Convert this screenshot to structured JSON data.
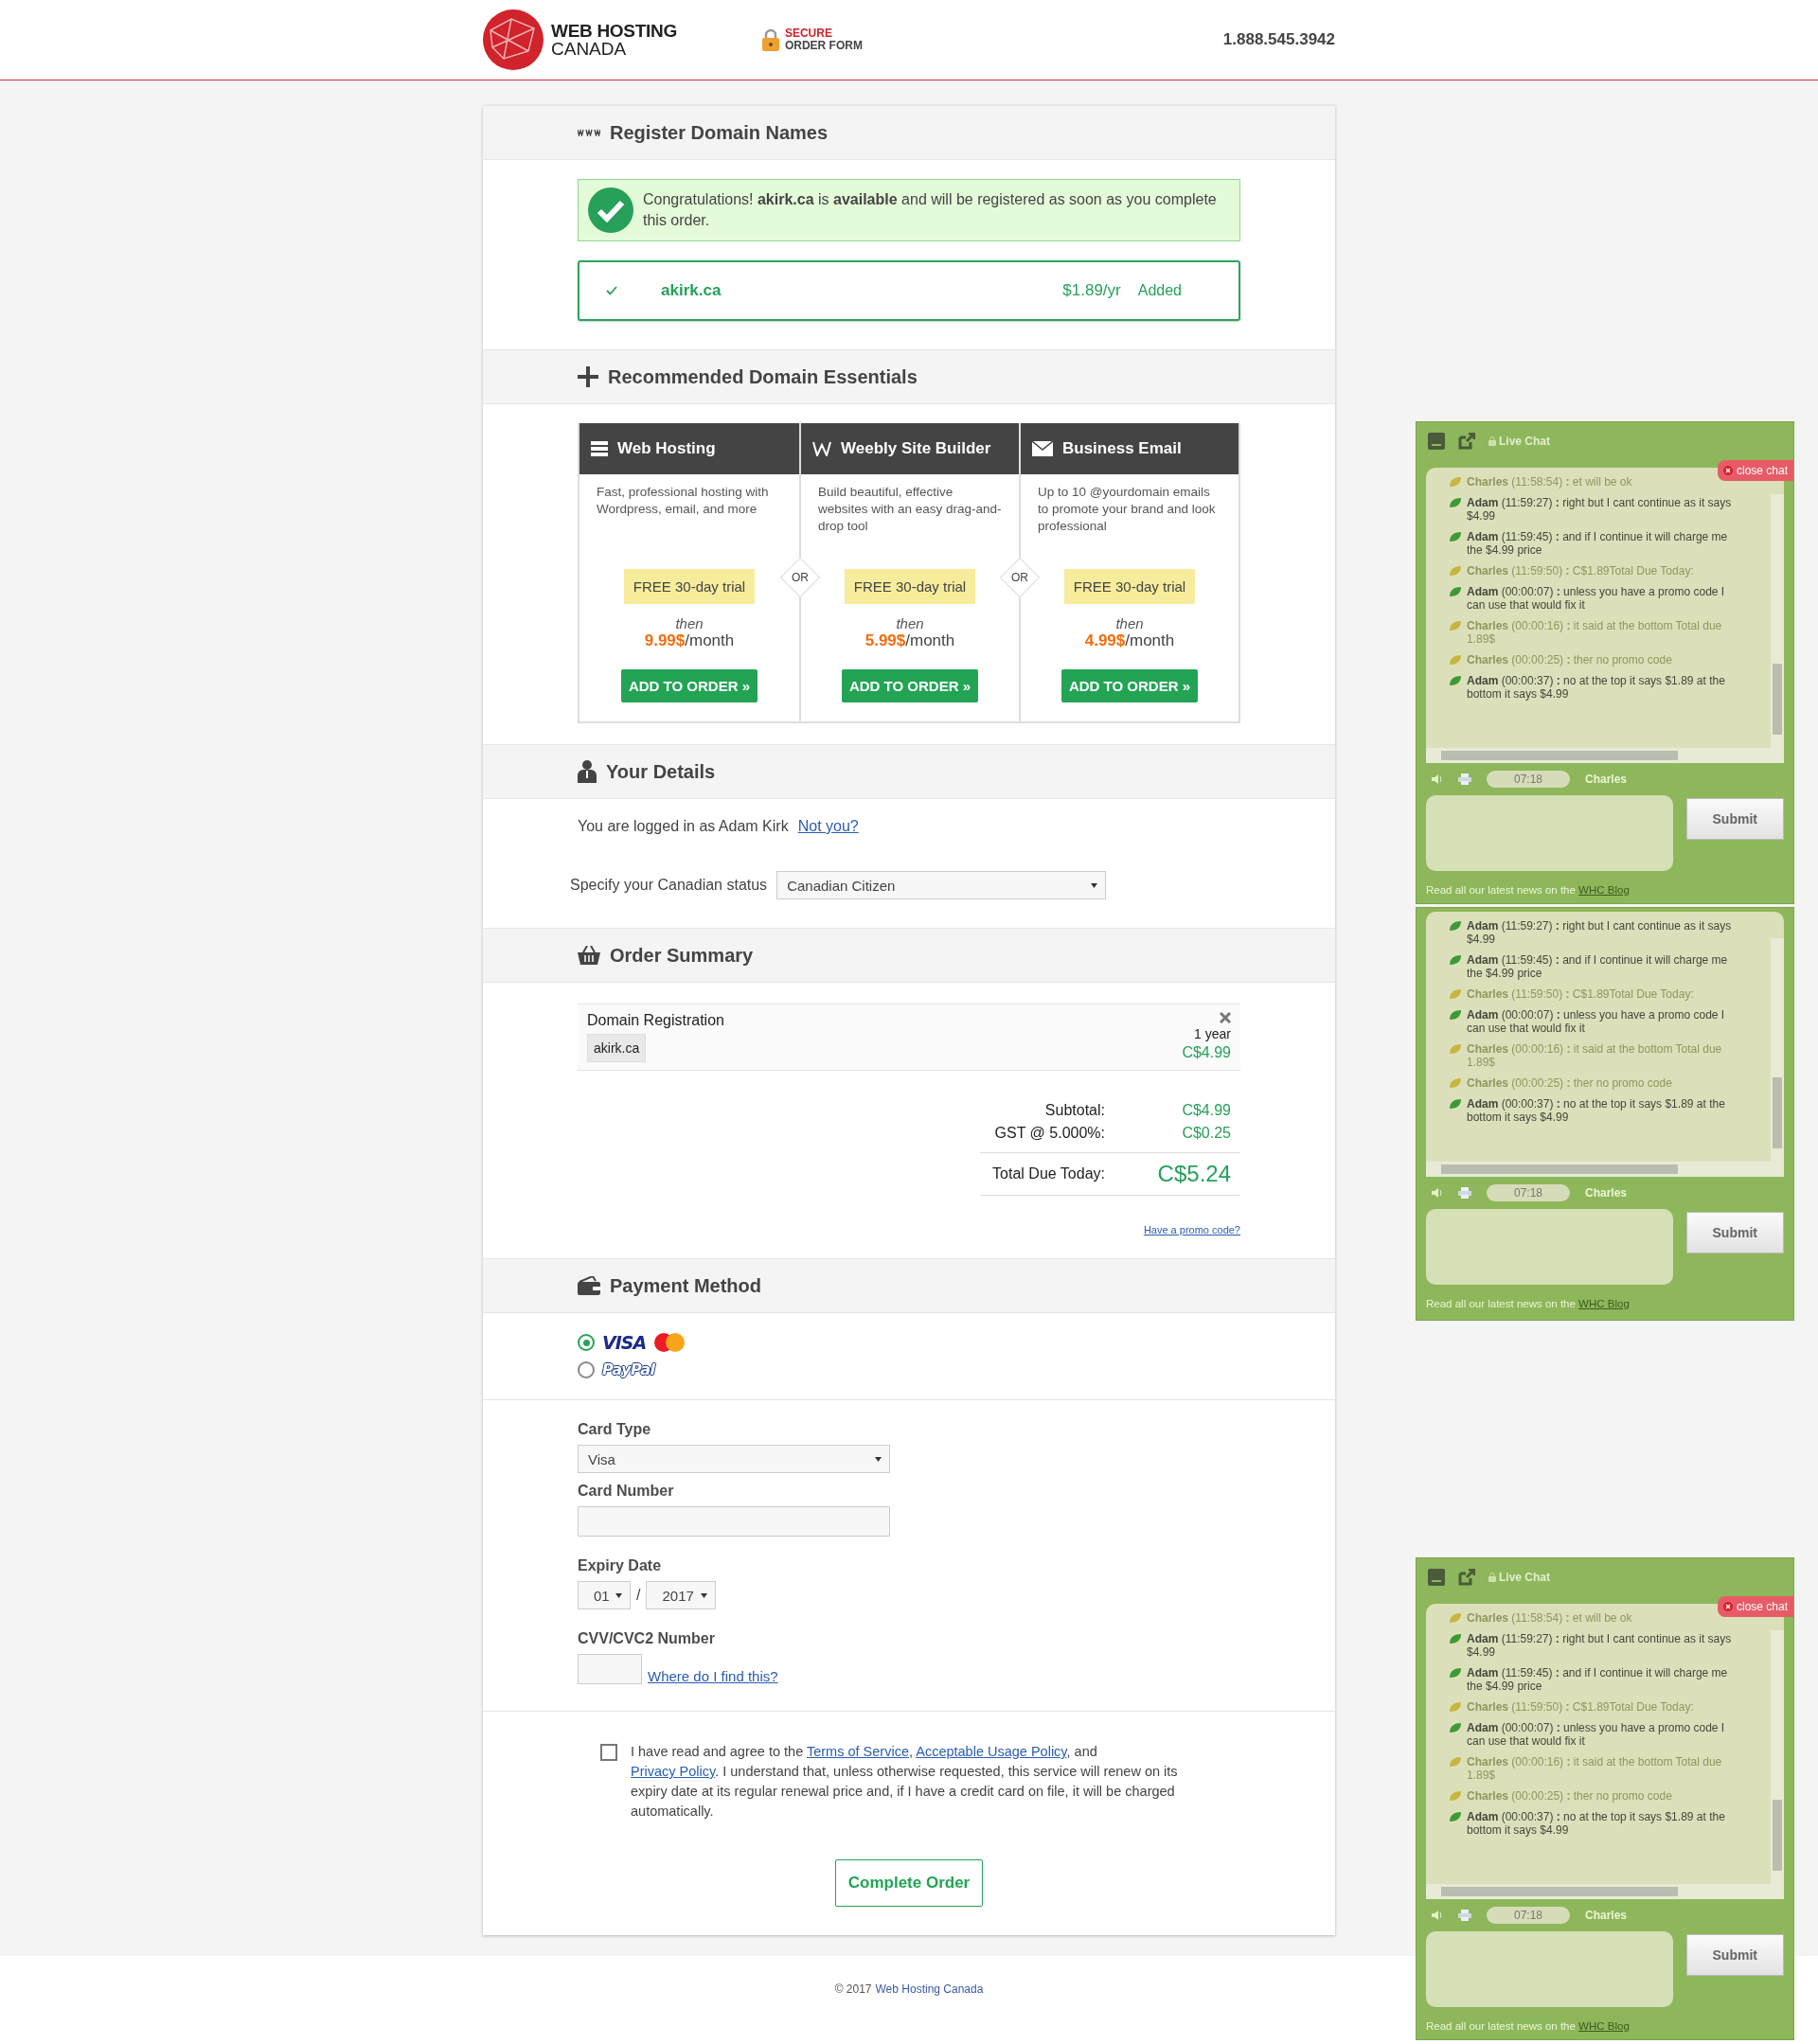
{
  "header": {
    "logo_line1": "WEB HOSTING",
    "logo_line2": "CANADA",
    "secure_line1": "SECURE",
    "secure_line2": "ORDER FORM",
    "phone": "1.888.545.3942"
  },
  "domains": {
    "title": "Register Domain Names",
    "alert": "Congratulations! **akirk.ca** is **available** and will be registered as soon as you complete this order.",
    "domain": "akirk.ca",
    "price": "$1.89/yr",
    "status": "Added"
  },
  "essentials": {
    "title": "Recommended Domain Essentials",
    "separators": [
      "OR",
      "OR"
    ],
    "plans": [
      {
        "kind": "hosting",
        "name": "Web Hosting",
        "description": "Fast, professional hosting with Wordpress, email, and more",
        "trial": "FREE 30-day trial",
        "then": "then",
        "price": "9.99$",
        "period": "/month",
        "button": "ADD TO ORDER »"
      },
      {
        "kind": "builder",
        "name": "Weebly Site Builder",
        "description": "Build beautiful, effective websites with an easy drag-and-drop tool",
        "trial": "FREE 30-day trial",
        "then": "then",
        "price": "5.99$",
        "period": "/month",
        "button": "ADD TO ORDER »"
      },
      {
        "kind": "email",
        "name": "Business Email",
        "description": "Up to 10 @yourdomain emails to promote your brand and look professional",
        "trial": "FREE 30-day trial",
        "then": "then",
        "price": "4.99$",
        "period": "/month",
        "button": "ADD TO ORDER »"
      }
    ]
  },
  "details": {
    "title": "Your Details",
    "logged_in": "You are logged in as Adam Kirk",
    "not_you": "Not you?",
    "status_label": "Specify your Canadian status",
    "status_value": "Canadian Citizen"
  },
  "summary": {
    "title": "Order Summary",
    "item": {
      "name": "Domain Registration",
      "domain": "akirk.ca",
      "term": "1 year",
      "price": "C$4.99"
    },
    "totals": [
      {
        "kind": "line",
        "label": "Subtotal:",
        "value": "C$4.99"
      },
      {
        "kind": "line",
        "label": "GST @ 5.000%:",
        "value": "C$0.25"
      },
      {
        "kind": "total",
        "label": "Total Due Today:",
        "value": "C$5.24"
      }
    ],
    "promo_link": "Have a promo code?"
  },
  "payment": {
    "title": "Payment Method",
    "methods": [
      {
        "kind": "card",
        "label": "VISA",
        "selected": true
      },
      {
        "kind": "paypal",
        "label": "PayPal",
        "selected": false
      }
    ],
    "card_type_label": "Card Type",
    "card_type_value": "Visa",
    "card_number_label": "Card Number",
    "expiry_label": "Expiry Date",
    "expiry_month": "01",
    "expiry_separator": "/",
    "expiry_year": "2017",
    "cvv_label": "CVV/CVC2 Number",
    "cvv_help": "Where do I find this?"
  },
  "agreement": {
    "checked": false,
    "parts": [
      {
        "kind": "text",
        "text": "I have read and agree to the "
      },
      {
        "kind": "link",
        "text": "Terms of Service"
      },
      {
        "kind": "text",
        "text": ", "
      },
      {
        "kind": "link",
        "text": "Acceptable Usage Policy"
      },
      {
        "kind": "text",
        "text": ", and "
      },
      {
        "kind": "link",
        "text": "Privacy Policy"
      },
      {
        "kind": "text",
        "text": ". I understand that, unless otherwise requested, this service will renew on its expiry date at its regular renewal price and, if I have a credit card on file, it will be charged automatically."
      }
    ]
  },
  "submit": "Complete Order",
  "footer": {
    "copyright": "© 2017",
    "link": "Web Hosting Canada"
  },
  "chats": [
    {
      "title": "Live Chat",
      "close": "close chat",
      "messages": [
        {
          "kind": "agent",
          "text": "**Charles** (11:58:54) **:** et will be ok"
        },
        {
          "kind": "visitor",
          "text": "**Adam** (11:59:27) **:** right but I cant continue as it says $4.99"
        },
        {
          "kind": "visitor",
          "text": "**Adam** (11:59:45) **:** and if I continue it will charge me the $4.99 price"
        },
        {
          "kind": "agent",
          "text": "**Charles** (11:59:50) **:** C$1.89Total Due Today:"
        },
        {
          "kind": "visitor",
          "text": "**Adam** (00:00:07) **:** unless you have a promo code I can use that would fix it"
        },
        {
          "kind": "agent",
          "text": "**Charles** (00:00:16) **:** it said at the bottom Total due 1.89$"
        },
        {
          "kind": "agent",
          "text": "**Charles** (00:00:25) **:** ther no promo code"
        },
        {
          "kind": "visitor",
          "text": "**Adam** (00:00:37) **:** no at the top it says $1.89 at the bottom it says $4.99"
        }
      ],
      "timer": "07:18",
      "agent": "Charles",
      "submit": "Submit",
      "footer_text": "Read all our latest news on the ",
      "footer_link": "WHC Blog"
    },
    {
      "messages": [
        {
          "kind": "visitor",
          "text": "**Adam** (11:59:27) **:** right but I cant continue as it says $4.99"
        },
        {
          "kind": "visitor",
          "text": "**Adam** (11:59:45) **:** and if I continue it will charge me the $4.99 price"
        },
        {
          "kind": "agent",
          "text": "**Charles** (11:59:50) **:** C$1.89Total Due Today:"
        },
        {
          "kind": "visitor",
          "text": "**Adam** (00:00:07) **:** unless you have a promo code I can use that would fix it"
        },
        {
          "kind": "agent",
          "text": "**Charles** (00:00:16) **:** it said at the bottom Total due 1.89$"
        },
        {
          "kind": "agent",
          "text": "**Charles** (00:00:25) **:** ther no promo code"
        },
        {
          "kind": "visitor",
          "text": "**Adam** (00:00:37) **:** no at the top it says $1.89 at the bottom it says $4.99"
        }
      ],
      "timer": "07:18",
      "agent": "Charles",
      "submit": "Submit",
      "footer_text": "Read all our latest news on the ",
      "footer_link": "WHC Blog"
    },
    {
      "title": "Live Chat",
      "close": "close chat",
      "messages": [
        {
          "kind": "agent",
          "text": "**Charles** (11:58:54) **:** et will be ok"
        },
        {
          "kind": "visitor",
          "text": "**Adam** (11:59:27) **:** right but I cant continue as it says $4.99"
        },
        {
          "kind": "visitor",
          "text": "**Adam** (11:59:45) **:** and if I continue it will charge me the $4.99 price"
        },
        {
          "kind": "agent",
          "text": "**Charles** (11:59:50) **:** C$1.89Total Due Today:"
        },
        {
          "kind": "visitor",
          "text": "**Adam** (00:00:07) **:** unless you have a promo code I can use that would fix it"
        },
        {
          "kind": "agent",
          "text": "**Charles** (00:00:16) **:** it said at the bottom Total due 1.89$"
        },
        {
          "kind": "agent",
          "text": "**Charles** (00:00:25) **:** ther no promo code"
        },
        {
          "kind": "visitor",
          "text": "**Adam** (00:00:37) **:** no at the top it says $1.89 at the bottom it says $4.99"
        }
      ],
      "timer": "07:18",
      "agent": "Charles",
      "submit": "Submit",
      "footer_text": "Read all our latest news on the ",
      "footer_link": "WHC Blog"
    }
  ]
}
